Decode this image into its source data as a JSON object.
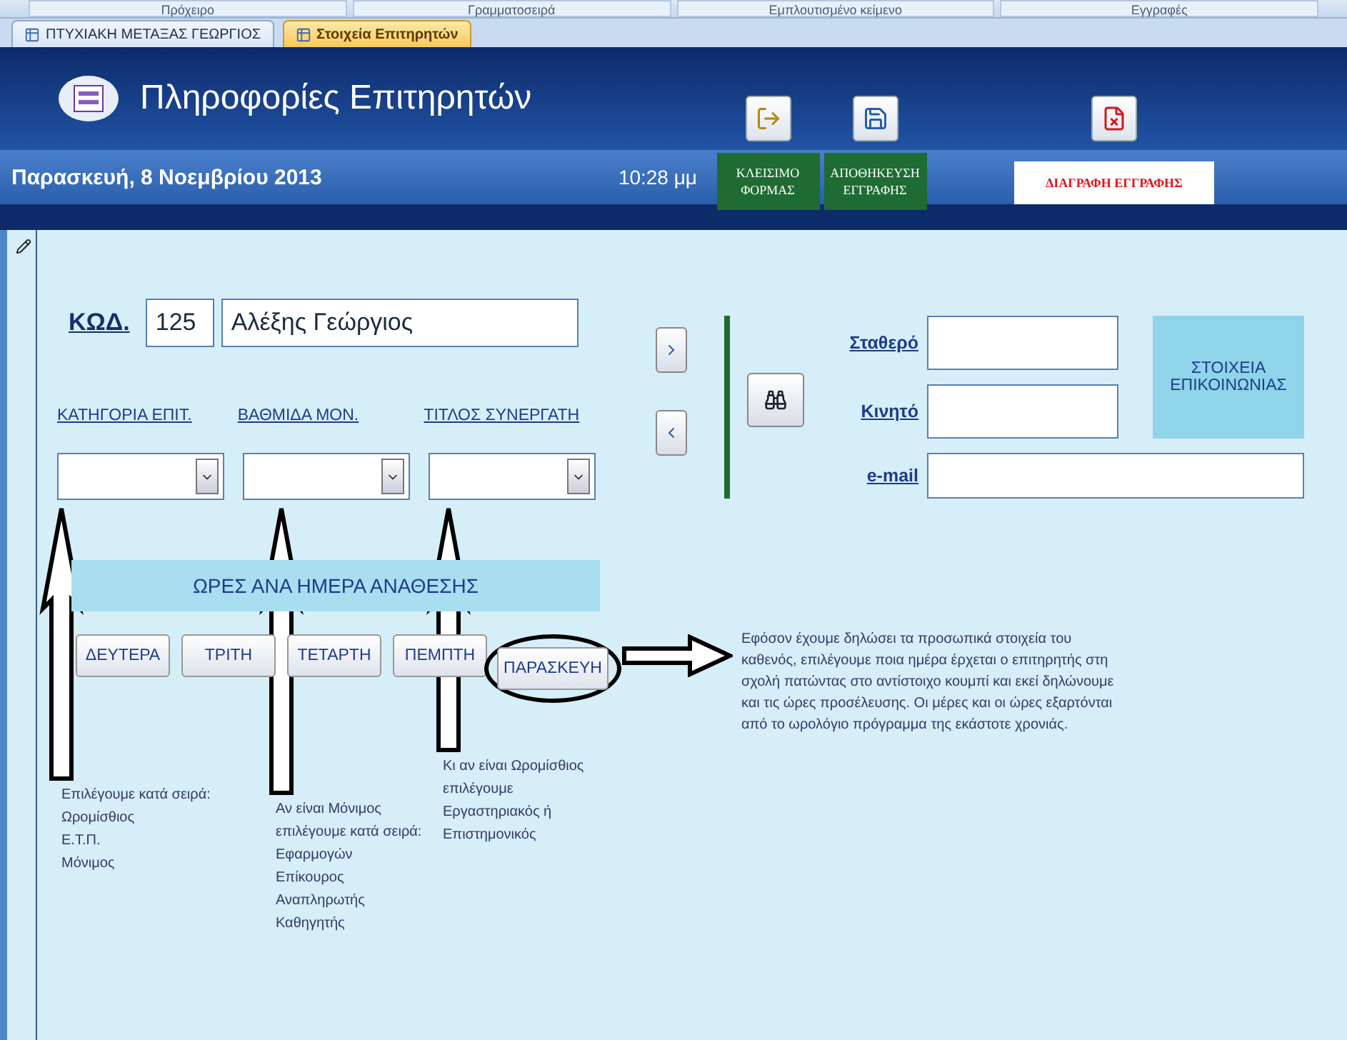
{
  "ribbon": {
    "groups": [
      "Πρόχειρο",
      "Γραμματοσειρά",
      "Εμπλουτισμένο κείμενο",
      "Εγγραφές"
    ]
  },
  "tabs": [
    {
      "label": "ΠΤΥΧΙΑΚΗ ΜΕΤΑΞΑΣ ΓΕΩΡΓΙΟΣ",
      "selected": false
    },
    {
      "label": "Στοιχεία Επιτηρητών",
      "selected": true
    }
  ],
  "header": {
    "title": "Πληροφορίες Επιτηρητών",
    "date": "Παρασκευή, 8 Νοεμβρίου 2013",
    "time": "10:28 μμ",
    "actions": [
      {
        "kind": "close",
        "label": "ΚΛΕΙΣΙΜΟ ΦΟΡΜΑΣ"
      },
      {
        "kind": "save",
        "label": "ΑΠΟΘΗΚΕΥΣΗ ΕΓΓΡΑΦΗΣ"
      },
      {
        "kind": "delete",
        "label": "ΔΙΑΓΡΑΦΗ ΕΓΓΡΑΦΗΣ"
      }
    ]
  },
  "record": {
    "code_label": "ΚΩΔ.",
    "code": "125",
    "name": "Αλέξης Γεώργιος"
  },
  "combos": [
    {
      "label": "ΚΑΤΗΓΟΡΙΑ ΕΠΙΤ."
    },
    {
      "label": "ΒΑΘΜΙΔΑ ΜΟΝ."
    },
    {
      "label": "ΤΙΤΛΟΣ ΣΥΝΕΡΓΑΤΗ"
    }
  ],
  "contact": {
    "fields": [
      {
        "label": "Σταθερό"
      },
      {
        "label": "Κινητό"
      },
      {
        "label": "e-mail"
      }
    ],
    "section_title": "ΣΤΟΙΧΕΙΑ ΕΠΙΚΟΙΝΩΝΙΑΣ"
  },
  "schedule": {
    "title": "ΩΡΕΣ ΑΝΑ ΗΜΕΡΑ ΑΝΑΘΕΣΗΣ",
    "days": [
      {
        "label": "ΔΕΥΤΕΡΑ",
        "circled": false
      },
      {
        "label": "ΤΡΙΤΗ",
        "circled": false
      },
      {
        "label": "ΤΕΤΑΡΤΗ",
        "circled": false
      },
      {
        "label": "ΠΕΜΠΤΗ",
        "circled": false
      },
      {
        "label": "ΠΑΡΑΣΚΕΥΗ",
        "circled": true
      }
    ]
  },
  "annotations": {
    "explanation": "Εφόσον έχουμε δηλώσει τα προσωπικά στοιχεία του καθενός, επιλέγουμε ποια ημέρα έρχεται ο επιτηρητής στη σχολή πατώντας στο αντίστοιχο κουμπί και εκεί δηλώνουμε και τις ώρες προσέλευσης. Οι μέρες και οι ώρες εξαρτόνται από το ωρολόγιο πρόγραμμα της εκάστοτε χρονιάς.",
    "notes": [
      {
        "lines": [
          "Επιλέγουμε κατά σειρά:",
          "Ωρομίσθιος",
          "Ε.Τ.Π.",
          "Μόνιμος"
        ]
      },
      {
        "lines": [
          "Αν είναι Μόνιμος",
          "επιλέγουμε κατά σειρά:",
          "Εφαρμογών",
          "Επίκουρος",
          "Αναπληρωτής",
          "Καθηγητής"
        ]
      },
      {
        "lines": [
          "Κι αν είναι Ωρομίσθιος",
          "επιλέγουμε",
          "Εργαστηριακός ή",
          "Επιστημονικός"
        ]
      }
    ]
  }
}
